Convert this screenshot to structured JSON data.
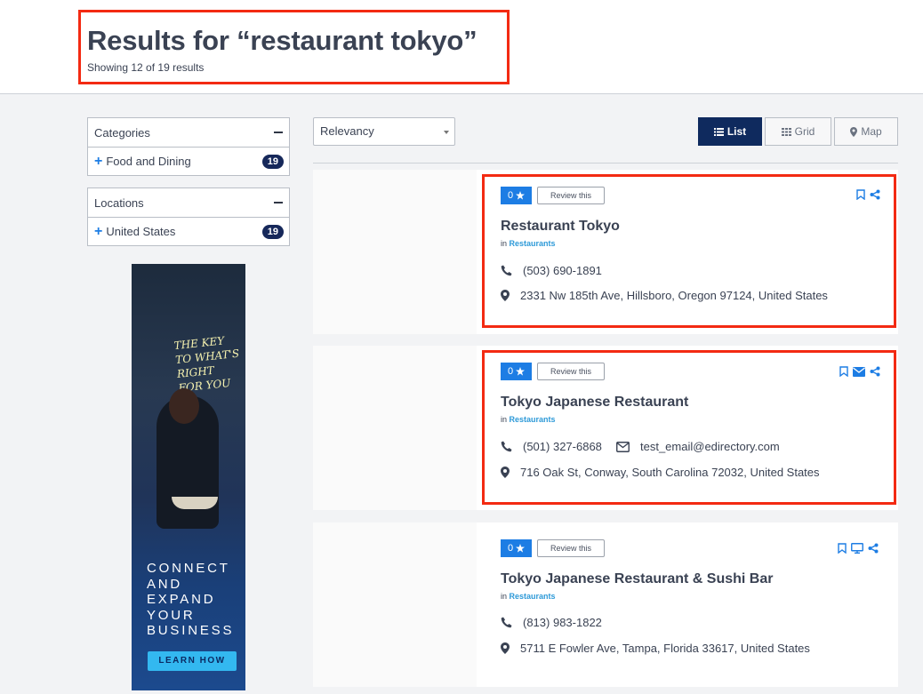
{
  "search": {
    "title": "Results for “restaurant tokyo”",
    "summary": "Showing 12 of 19 results"
  },
  "filters": {
    "categories": {
      "heading": "Categories",
      "items": [
        {
          "label": "Food and Dining",
          "count": "19"
        }
      ]
    },
    "locations": {
      "heading": "Locations",
      "items": [
        {
          "label": "United States",
          "count": "19"
        }
      ]
    }
  },
  "ad": {
    "neon": [
      "THE KEY",
      "TO WHAT'S RIGHT",
      "FOR YOU"
    ],
    "lines": [
      "CONNECT",
      "AND",
      "EXPAND",
      "YOUR",
      "BUSINESS"
    ],
    "button": "LEARN HOW"
  },
  "toolbar": {
    "sort_value": "Relevancy",
    "views": {
      "list": "List",
      "grid": "Grid",
      "map": "Map"
    }
  },
  "listings": [
    {
      "rating": "0",
      "review_label": "Review this",
      "name": "Restaurant Tokyo",
      "in_label": "in",
      "category": "Restaurants",
      "phone": "(503) 690-1891",
      "email": "",
      "address": "2331 Nw 185th Ave, Hillsboro, Oregon 97124, United States"
    },
    {
      "rating": "0",
      "review_label": "Review this",
      "name": "Tokyo Japanese Restaurant",
      "in_label": "in",
      "category": "Restaurants",
      "phone": "(501) 327-6868",
      "email": "test_email@edirectory.com",
      "address": "716 Oak St, Conway, South Carolina 72032, United States"
    },
    {
      "rating": "0",
      "review_label": "Review this",
      "name": "Tokyo Japanese Restaurant & Sushi Bar",
      "in_label": "in",
      "category": "Restaurants",
      "phone": "(813) 983-1822",
      "email": "",
      "address": "5711 E Fowler Ave, Tampa, Florida 33617, United States"
    }
  ],
  "colors": {
    "highlight": "#f32a12",
    "navy": "#0f2a5e",
    "accent": "#1d7de4",
    "link": "#2e9ad8"
  }
}
